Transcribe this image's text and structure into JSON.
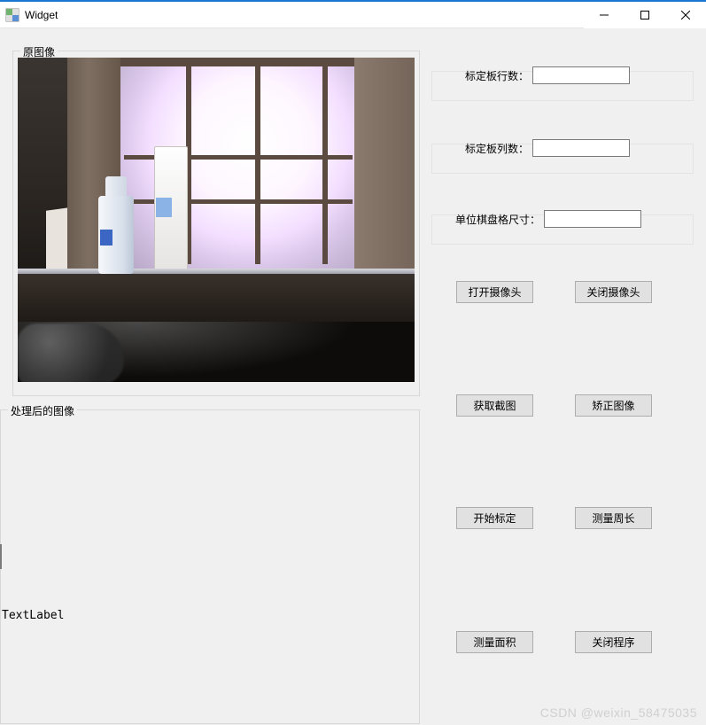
{
  "window": {
    "title": "Widget"
  },
  "groups": {
    "original": "原图像",
    "processed": "处理后的图像"
  },
  "fields": {
    "rows": {
      "label": "标定板行数：",
      "value": ""
    },
    "cols": {
      "label": "标定板列数：",
      "value": ""
    },
    "square": {
      "label": "单位棋盘格尺寸：",
      "value": ""
    }
  },
  "buttons": {
    "open_camera": "打开摄像头",
    "close_camera": "关闭摄像头",
    "capture": "获取截图",
    "rectify": "矫正图像",
    "start_calib": "开始标定",
    "measure_perim": "测量周长",
    "measure_area": "测量面积",
    "close_program": "关闭程序"
  },
  "labels": {
    "textlabel": "TextLabel"
  },
  "watermark": "CSDN @weixin_58475035",
  "titlebar_icons": {
    "minimize": "minimize-icon",
    "maximize": "maximize-icon",
    "close": "close-icon"
  }
}
